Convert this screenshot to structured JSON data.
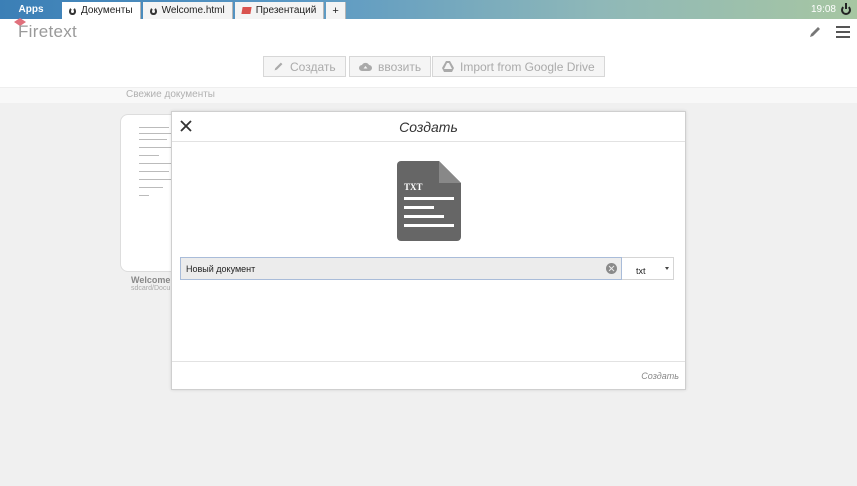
{
  "system_bar": {
    "apps_label": "Apps",
    "tabs": [
      {
        "label": "Документы",
        "icon": "firetext-icon",
        "active": true
      },
      {
        "label": "Welcome.html",
        "icon": "firetext-icon",
        "active": false
      },
      {
        "label": "Презентаций",
        "icon": "presentation-icon",
        "active": false
      },
      {
        "label": "+",
        "icon": "",
        "active": false
      }
    ],
    "clock": "19:08",
    "power_icon": "power-icon"
  },
  "app_header": {
    "logo_text": "Firetext",
    "edit_icon": "pencil-icon",
    "menu_icon": "hamburger-menu-icon"
  },
  "toolbar": {
    "create_label": "Создать",
    "import_label": "ввозить",
    "drive_label": "Import from Google Drive"
  },
  "recent": {
    "title": "Свежие документы",
    "documents": [
      {
        "name": "Welcome",
        "path": "sdcard/Docu"
      }
    ]
  },
  "modal": {
    "title": "Создать",
    "file_icon_label": "TXT",
    "name_value": "Новый документ",
    "type_selected": "txt",
    "footer_create_label": "Создать"
  },
  "colors": {
    "sysbar_start": "#3b7fb6",
    "sysbar_end": "#a7c6a2",
    "file_icon": "#666666",
    "logo_accent": "#e0707c"
  }
}
